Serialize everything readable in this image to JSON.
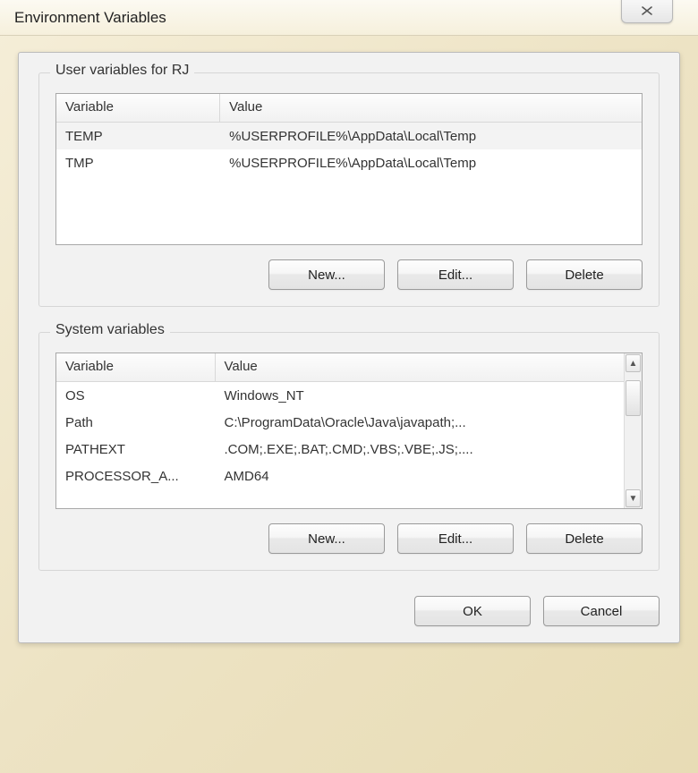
{
  "window": {
    "title": "Environment Variables"
  },
  "user_section": {
    "title": "User variables for RJ",
    "headers": {
      "variable": "Variable",
      "value": "Value"
    },
    "rows": [
      {
        "name": "TEMP",
        "value": "%USERPROFILE%\\AppData\\Local\\Temp",
        "selected": true
      },
      {
        "name": "TMP",
        "value": "%USERPROFILE%\\AppData\\Local\\Temp",
        "selected": false
      }
    ],
    "buttons": {
      "new": "New...",
      "edit": "Edit...",
      "delete": "Delete"
    }
  },
  "system_section": {
    "title": "System variables",
    "headers": {
      "variable": "Variable",
      "value": "Value"
    },
    "rows": [
      {
        "name": "OS",
        "value": "Windows_NT"
      },
      {
        "name": "Path",
        "value": "C:\\ProgramData\\Oracle\\Java\\javapath;..."
      },
      {
        "name": "PATHEXT",
        "value": ".COM;.EXE;.BAT;.CMD;.VBS;.VBE;.JS;...."
      },
      {
        "name": "PROCESSOR_A...",
        "value": "AMD64"
      }
    ],
    "buttons": {
      "new": "New...",
      "edit": "Edit...",
      "delete": "Delete"
    }
  },
  "dialog_buttons": {
    "ok": "OK",
    "cancel": "Cancel"
  }
}
